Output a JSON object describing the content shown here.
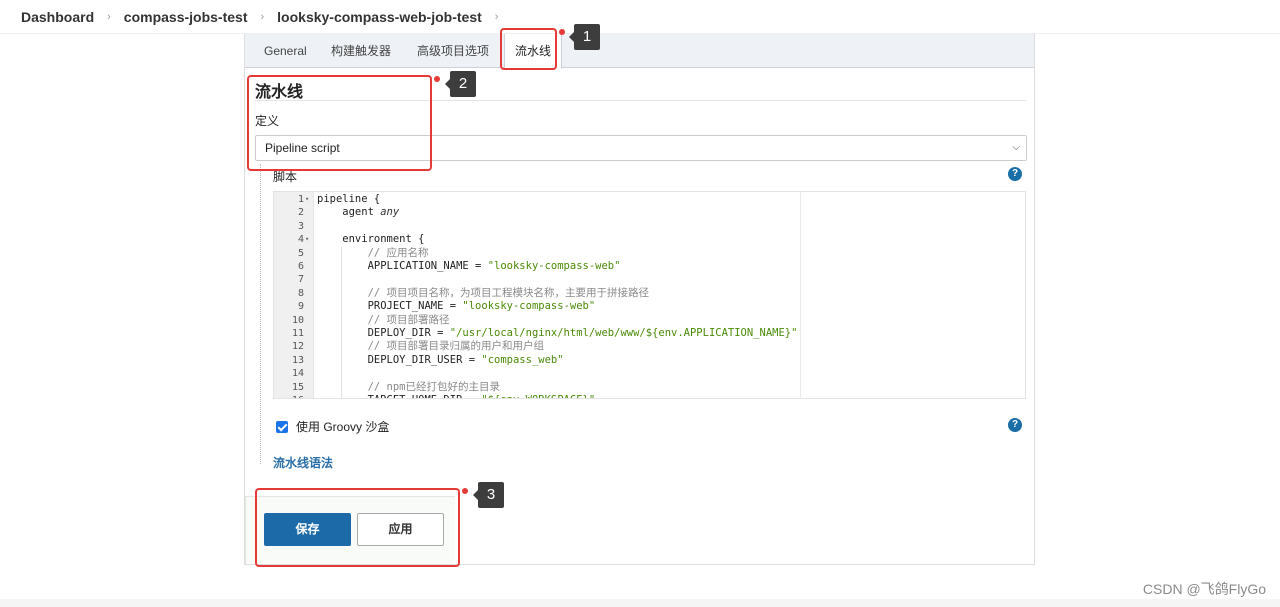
{
  "breadcrumb": {
    "items": [
      "Dashboard",
      "compass-jobs-test",
      "looksky-compass-web-job-test"
    ],
    "separator_icon": "chevron-right-icon"
  },
  "tabs": {
    "general": "General",
    "triggers": "构建触发器",
    "advanced": "高级项目选项",
    "pipeline": "流水线",
    "active": "流水线"
  },
  "pipeline_section": {
    "title": "流水线",
    "definition_label": "定义",
    "definition_value": "Pipeline script",
    "script_label": "脚本",
    "help_icon": "question-circle-icon"
  },
  "editor": {
    "lines": [
      {
        "n": "1",
        "text": "pipeline {",
        "fold": true
      },
      {
        "n": "2",
        "text": "    agent any"
      },
      {
        "n": "3",
        "text": ""
      },
      {
        "n": "4",
        "text": "    environment {",
        "fold": true
      },
      {
        "n": "5",
        "text": "        // 应用名称"
      },
      {
        "n": "6",
        "text": "        APPLICATION_NAME = \"looksky-compass-web\""
      },
      {
        "n": "7",
        "text": ""
      },
      {
        "n": "8",
        "text": "        // 项目项目名称，为项目工程模块名称，主要用于拼接路径"
      },
      {
        "n": "9",
        "text": "        PROJECT_NAME = \"looksky-compass-web\""
      },
      {
        "n": "10",
        "text": "        // 项目部署路径"
      },
      {
        "n": "11",
        "text": "        DEPLOY_DIR = \"/usr/local/nginx/html/web/www/${env.APPLICATION_NAME}\""
      },
      {
        "n": "12",
        "text": "        // 项目部署目录归属的用户和用户组"
      },
      {
        "n": "13",
        "text": "        DEPLOY_DIR_USER = \"compass_web\""
      },
      {
        "n": "14",
        "text": ""
      },
      {
        "n": "15",
        "text": "        // npm已经打包好的主目录"
      },
      {
        "n": "16",
        "text": "        TARGET_HOME_DIR = \"${env.WORKSPACE}\""
      }
    ]
  },
  "groovy": {
    "label": "使用 Groovy 沙盒",
    "checked": true
  },
  "syntax_link": "流水线语法",
  "buttons": {
    "save": "保存",
    "apply": "应用"
  },
  "annotations": [
    "1",
    "2",
    "3"
  ],
  "watermark": "CSDN @飞鸽FlyGo",
  "colors": {
    "primary_button": "#1d6aa8",
    "annotation_red": "#e53935",
    "link": "#2a6fa8",
    "string": "#4a8a06"
  }
}
